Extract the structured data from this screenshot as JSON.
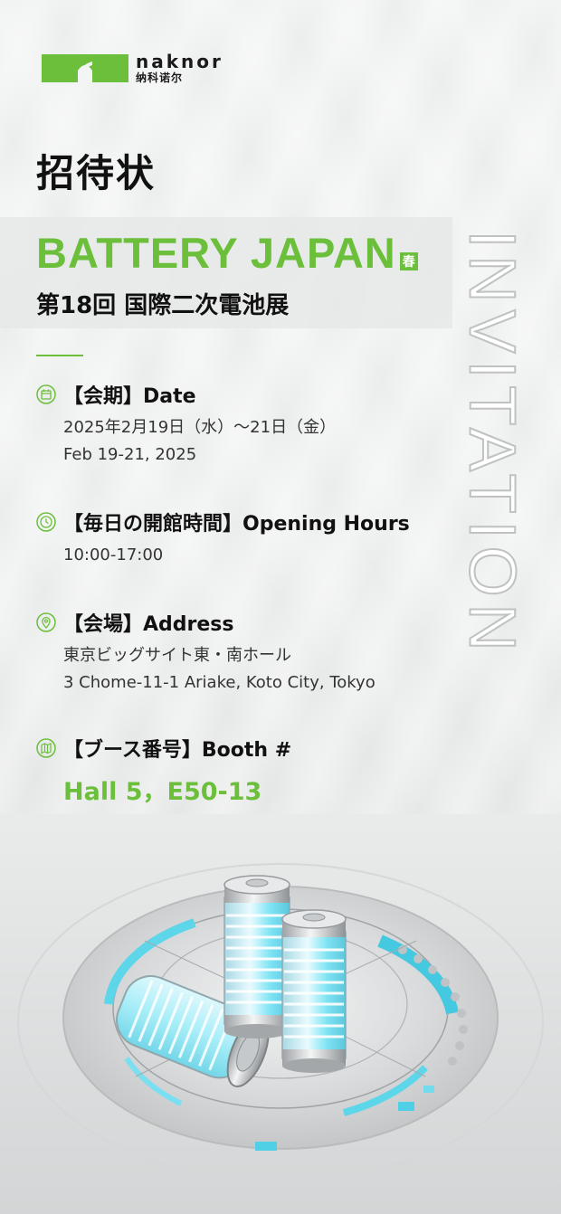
{
  "brand": {
    "name_en": "naknor",
    "name_cn": "纳科诺尔",
    "accent_color": "#6bbf3a"
  },
  "vertical_word": "INVITATION",
  "title": "招待状",
  "event": {
    "name_en": "BATTERY JAPAN",
    "season_badge": "春",
    "name_jp": "第18回 国際二次電池展"
  },
  "info": {
    "date": {
      "icon": "calendar-icon",
      "heading": "【会期】Date",
      "lines": [
        "2025年2月19日（水）～21日（金）",
        "Feb 19-21, 2025"
      ]
    },
    "hours": {
      "icon": "clock-icon",
      "heading": "【毎日の開館時間】Opening Hours",
      "lines": [
        "10:00-17:00"
      ]
    },
    "address": {
      "icon": "location-pin-icon",
      "heading": "【会場】Address",
      "lines": [
        "東京ビッグサイト東・南ホール",
        "3 Chome-11-1 Ariake, Koto City, Tokyo"
      ]
    },
    "booth": {
      "icon": "map-icon",
      "heading": "【ブース番号】Booth #",
      "value": "Hall 5，E50-13"
    }
  }
}
